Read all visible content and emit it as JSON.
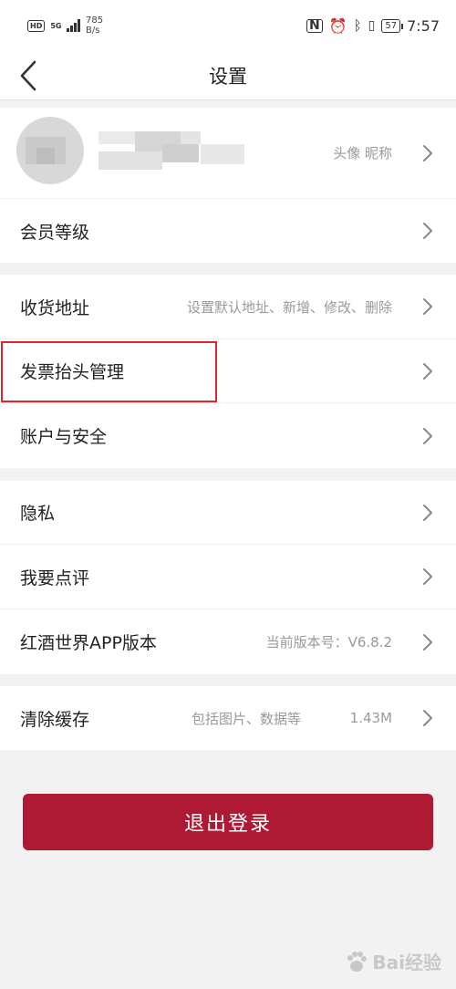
{
  "status_bar": {
    "hd": "HD",
    "net_type": "5G",
    "net_speed_value": "785",
    "net_speed_unit": "B/s",
    "battery": "57",
    "time": "7:57"
  },
  "nav": {
    "title": "设置"
  },
  "profile": {
    "value": "头像 昵称"
  },
  "group1": {
    "member_label": "会员等级"
  },
  "group2": {
    "address_label": "收货地址",
    "address_value": "设置默认地址、新增、修改、删除",
    "invoice_label": "发票抬头管理",
    "account_label": "账户与安全"
  },
  "group3": {
    "privacy_label": "隐私",
    "review_label": "我要点评",
    "version_label": "红酒世界APP版本",
    "version_value": "当前版本号：V6.8.2"
  },
  "group4": {
    "cache_label": "清除缓存",
    "cache_desc": "包括图片、数据等",
    "cache_size": "1.43M"
  },
  "logout_label": "退出登录",
  "watermark": "Bai经验",
  "colors": {
    "accent": "#ae1a34",
    "highlight": "#e0262b"
  }
}
